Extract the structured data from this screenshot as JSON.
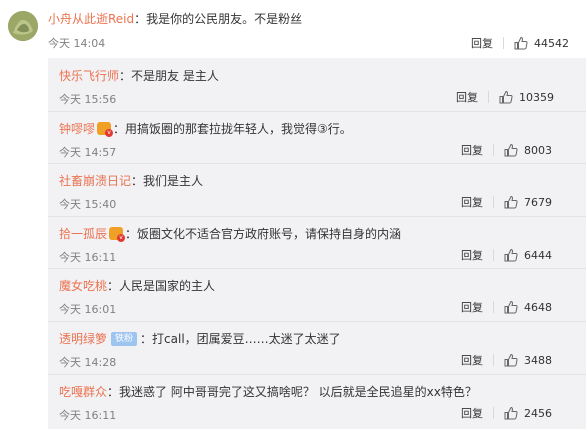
{
  "top_comment": {
    "username": "小舟从此逝Reid",
    "text": "我是你的公民朋友。不是粉丝",
    "time": "今天 14:04",
    "reply_label": "回复",
    "likes": "44542"
  },
  "replies": [
    {
      "username": "快乐飞行师",
      "text": "不是朋友 是主人",
      "time": "今天 15:56",
      "reply_label": "回复",
      "likes": "10359",
      "badge": ""
    },
    {
      "username": "钟嘐嘐",
      "text": "用搞饭圈的那套拉拢年轻人，我觉得③行。",
      "time": "今天 14:57",
      "reply_label": "回复",
      "likes": "8003",
      "badge": "vip"
    },
    {
      "username": "社畜崩溃日记",
      "text": "我们是主人",
      "time": "今天 15:40",
      "reply_label": "回复",
      "likes": "7679",
      "badge": ""
    },
    {
      "username": "拾一孤辰",
      "text": "饭圈文化不适合官方政府账号，请保持自身的内涵",
      "time": "今天 16:11",
      "reply_label": "回复",
      "likes": "6444",
      "badge": "vip"
    },
    {
      "username": "魔女吃桃",
      "text": "人民是国家的主人",
      "time": "今天 16:01",
      "reply_label": "回复",
      "likes": "4648",
      "badge": ""
    },
    {
      "username": "透明绿箩",
      "text": "打call，团属爱豆……太迷了太迷了",
      "time": "今天 14:28",
      "reply_label": "回复",
      "likes": "3488",
      "badge": "fan",
      "badge_text": "铁粉"
    },
    {
      "username": "吃嘎群众",
      "text": "我迷惑了 阿中哥哥完了这又搞啥呢？ 以后就是全民追星的xx特色？",
      "time": "今天 16:11",
      "reply_label": "回复",
      "likes": "2456",
      "badge": ""
    }
  ],
  "icons": {
    "like": "thumbs-up-icon",
    "vip": "vip-badge-icon"
  },
  "colors": {
    "username": "#eb7350",
    "panel_bg": "#f2f2f5",
    "fan_badge": "#9ec5f0"
  }
}
